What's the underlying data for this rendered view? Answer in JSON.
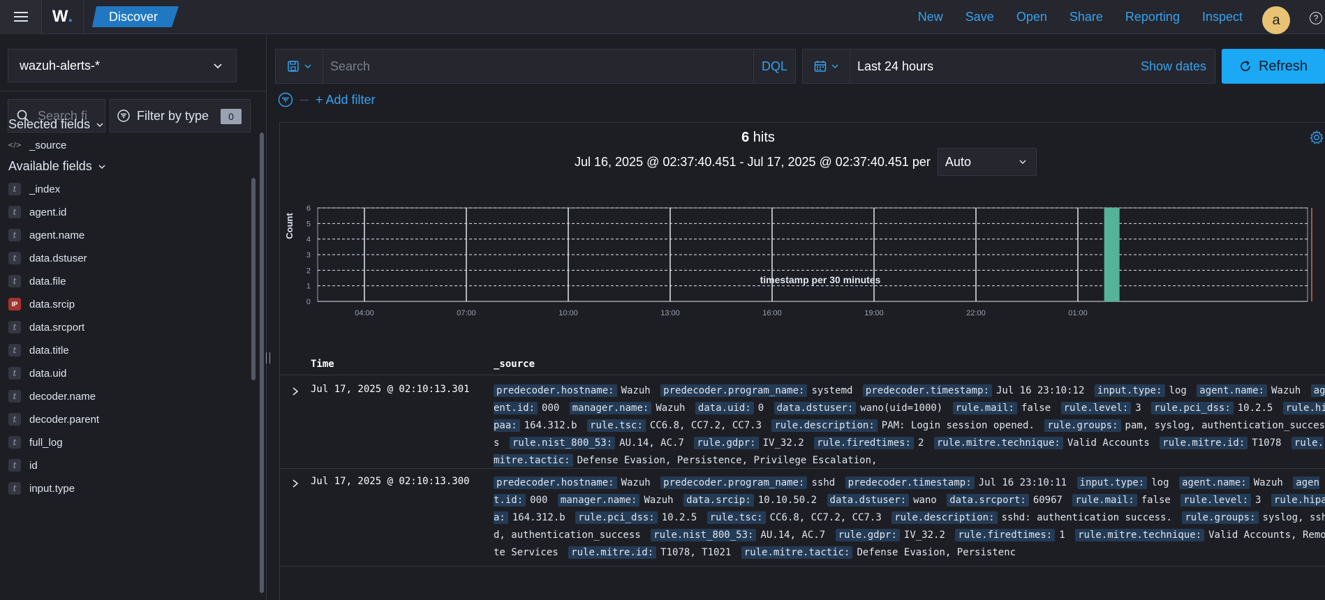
{
  "header": {
    "logo_text": "W",
    "breadcrumb": "Discover",
    "links": [
      "New",
      "Save",
      "Open",
      "Share",
      "Reporting",
      "Inspect"
    ],
    "avatar_initial": "a",
    "help_glyph": "?"
  },
  "sidebar": {
    "index_pattern": "wazuh-alerts-*",
    "search_placeholder": "Search fi",
    "filter_by_type_label": "Filter by type",
    "filter_count": "0",
    "selected_fields_title": "Selected fields",
    "selected_fields": [
      {
        "name": "_source",
        "type": "source"
      }
    ],
    "available_fields_title": "Available fields",
    "available_fields": [
      {
        "name": "_index",
        "type": "string"
      },
      {
        "name": "agent.id",
        "type": "string"
      },
      {
        "name": "agent.name",
        "type": "string"
      },
      {
        "name": "data.dstuser",
        "type": "string"
      },
      {
        "name": "data.file",
        "type": "string"
      },
      {
        "name": "data.srcip",
        "type": "ip"
      },
      {
        "name": "data.srcport",
        "type": "string"
      },
      {
        "name": "data.title",
        "type": "string"
      },
      {
        "name": "data.uid",
        "type": "string"
      },
      {
        "name": "decoder.name",
        "type": "string"
      },
      {
        "name": "decoder.parent",
        "type": "string"
      },
      {
        "name": "full_log",
        "type": "string"
      },
      {
        "name": "id",
        "type": "string"
      },
      {
        "name": "input.type",
        "type": "string"
      }
    ]
  },
  "query": {
    "placeholder": "Search",
    "language": "DQL"
  },
  "date_picker": {
    "range": "Last 24 hours",
    "show_dates": "Show dates",
    "refresh": "Refresh"
  },
  "filters": {
    "add_filter": "+ Add filter"
  },
  "results": {
    "hits_count": "6",
    "hits_label": "hits",
    "time_range": "Jul 16, 2025 @ 02:37:40.451 - Jul 17, 2025 @ 02:37:40.451 per",
    "interval": "Auto"
  },
  "chart_data": {
    "type": "bar",
    "ylabel": "Count",
    "xlabel": "timestamp per 30 minutes",
    "ylim": [
      0,
      6
    ],
    "y_ticks": [
      "0",
      "1",
      "2",
      "3",
      "4",
      "5",
      "6"
    ],
    "x_ticks": [
      "04:00",
      "07:00",
      "10:00",
      "13:00",
      "16:00",
      "19:00",
      "22:00",
      "01:00"
    ],
    "bars": [
      {
        "x": "02:00",
        "value": 6
      }
    ],
    "bar_color": "#54b399",
    "grid": true
  },
  "table": {
    "columns": [
      "Time",
      "_source"
    ],
    "rows": [
      {
        "time": "Jul 17, 2025 @ 02:10:13.301",
        "fields": [
          {
            "k": "predecoder.hostname:",
            "v": "Wazuh"
          },
          {
            "k": "predecoder.program_name:",
            "v": "systemd"
          },
          {
            "k": "predecoder.timestamp:",
            "v": "Jul 16 23:10:12"
          },
          {
            "k": "input.type:",
            "v": "log"
          },
          {
            "k": "agent.name:",
            "v": "Wazuh"
          },
          {
            "k": "agent.id:",
            "v": "000"
          },
          {
            "k": "manager.name:",
            "v": "Wazuh"
          },
          {
            "k": "data.uid:",
            "v": "0"
          },
          {
            "k": "data.dstuser:",
            "v": "wano(uid=1000)"
          },
          {
            "k": "rule.mail:",
            "v": "false"
          },
          {
            "k": "rule.level:",
            "v": "3"
          },
          {
            "k": "rule.pci_dss:",
            "v": "10.2.5"
          },
          {
            "k": "rule.hipaa:",
            "v": "164.312.b"
          },
          {
            "k": "rule.tsc:",
            "v": "CC6.8, CC7.2, CC7.3"
          },
          {
            "k": "rule.description:",
            "v": "PAM: Login session opened."
          },
          {
            "k": "rule.groups:",
            "v": "pam, syslog, authentication_success"
          },
          {
            "k": "rule.nist_800_53:",
            "v": "AU.14, AC.7"
          },
          {
            "k": "rule.gdpr:",
            "v": "IV_32.2"
          },
          {
            "k": "rule.firedtimes:",
            "v": "2"
          },
          {
            "k": "rule.mitre.technique:",
            "v": "Valid Accounts"
          },
          {
            "k": "rule.mitre.id:",
            "v": "T1078"
          },
          {
            "k": "rule.mitre.tactic:",
            "v": "Defense Evasion, Persistence, Privilege Escalation,"
          }
        ]
      },
      {
        "time": "Jul 17, 2025 @ 02:10:13.300",
        "fields": [
          {
            "k": "predecoder.hostname:",
            "v": "Wazuh"
          },
          {
            "k": "predecoder.program_name:",
            "v": "sshd"
          },
          {
            "k": "predecoder.timestamp:",
            "v": "Jul 16 23:10:11"
          },
          {
            "k": "input.type:",
            "v": "log"
          },
          {
            "k": "agent.name:",
            "v": "Wazuh"
          },
          {
            "k": "agent.id:",
            "v": "000"
          },
          {
            "k": "manager.name:",
            "v": "Wazuh"
          },
          {
            "k": "data.srcip:",
            "v": "10.10.50.2"
          },
          {
            "k": "data.dstuser:",
            "v": "wano"
          },
          {
            "k": "data.srcport:",
            "v": "60967"
          },
          {
            "k": "rule.mail:",
            "v": "false"
          },
          {
            "k": "rule.level:",
            "v": "3"
          },
          {
            "k": "rule.hipaa:",
            "v": "164.312.b"
          },
          {
            "k": "rule.pci_dss:",
            "v": "10.2.5"
          },
          {
            "k": "rule.tsc:",
            "v": "CC6.8, CC7.2, CC7.3"
          },
          {
            "k": "rule.description:",
            "v": "sshd: authentication success."
          },
          {
            "k": "rule.groups:",
            "v": "syslog, sshd, authentication_success"
          },
          {
            "k": "rule.nist_800_53:",
            "v": "AU.14, AC.7"
          },
          {
            "k": "rule.gdpr:",
            "v": "IV_32.2"
          },
          {
            "k": "rule.firedtimes:",
            "v": "1"
          },
          {
            "k": "rule.mitre.technique:",
            "v": "Valid Accounts, Remote Services"
          },
          {
            "k": "rule.mitre.id:",
            "v": "T1078, T1021"
          },
          {
            "k": "rule.mitre.tactic:",
            "v": "Defense Evasion, Persistenc"
          }
        ]
      }
    ]
  }
}
